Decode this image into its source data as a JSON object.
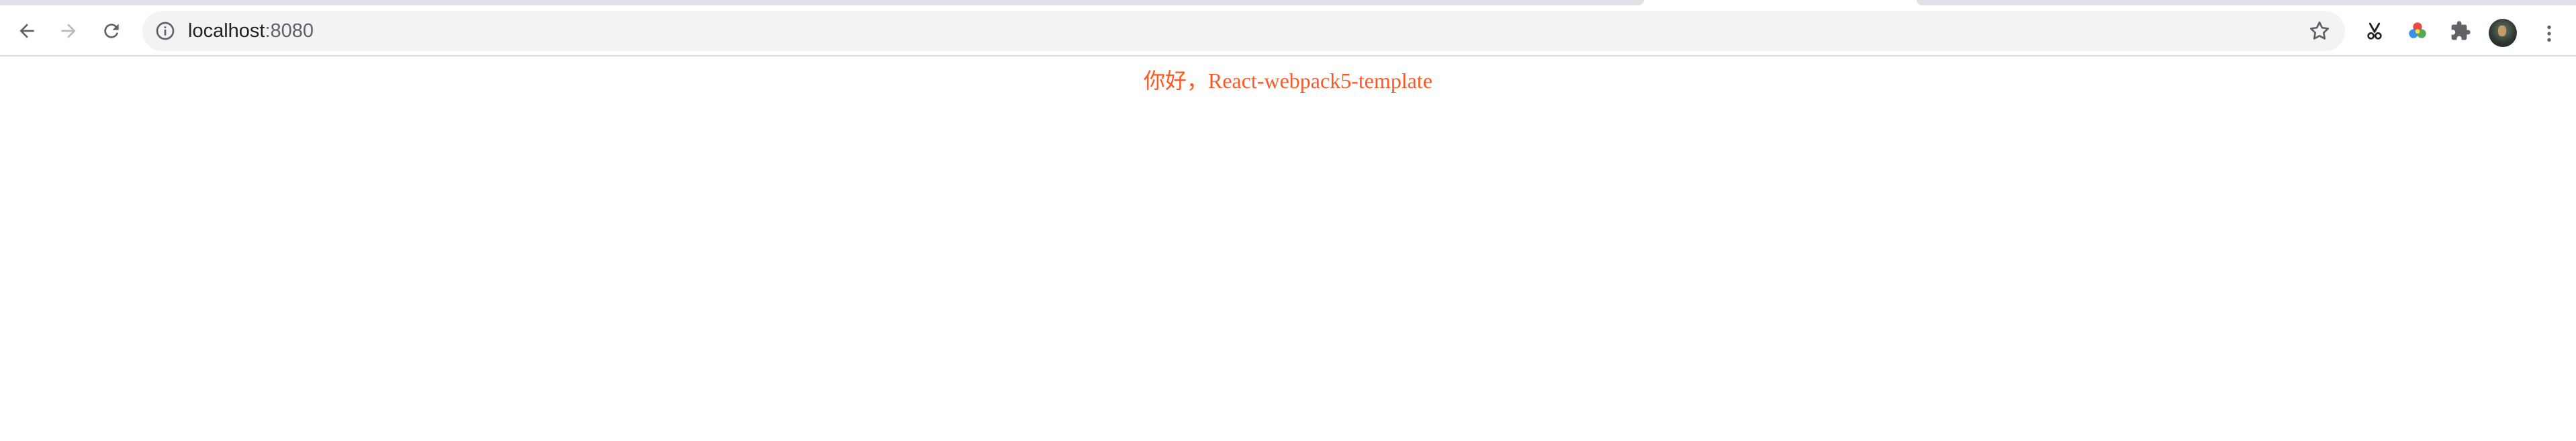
{
  "browser": {
    "omnibox": {
      "host": "localhost",
      "port": ":8080"
    },
    "icons": {
      "back": "arrow-left-icon",
      "forward": "arrow-right-icon",
      "reload": "reload-icon",
      "site_info": "info-circle-icon",
      "bookmark": "star-outline-icon",
      "extension_scissors": "scissors-icon",
      "extension_color": "color-wheel-icon",
      "extensions": "puzzle-piece-icon",
      "menu": "kebab-menu-icon"
    },
    "colors": {
      "toolbar": "#ffffff",
      "tabstrip": "#dee1e6",
      "omnibox": "#f1f3f4",
      "icon": "#5f6368",
      "icon_disabled": "#b8babd"
    }
  },
  "page": {
    "greeting": "你好，React-webpack5-template",
    "greeting_color": "#ff5722"
  }
}
